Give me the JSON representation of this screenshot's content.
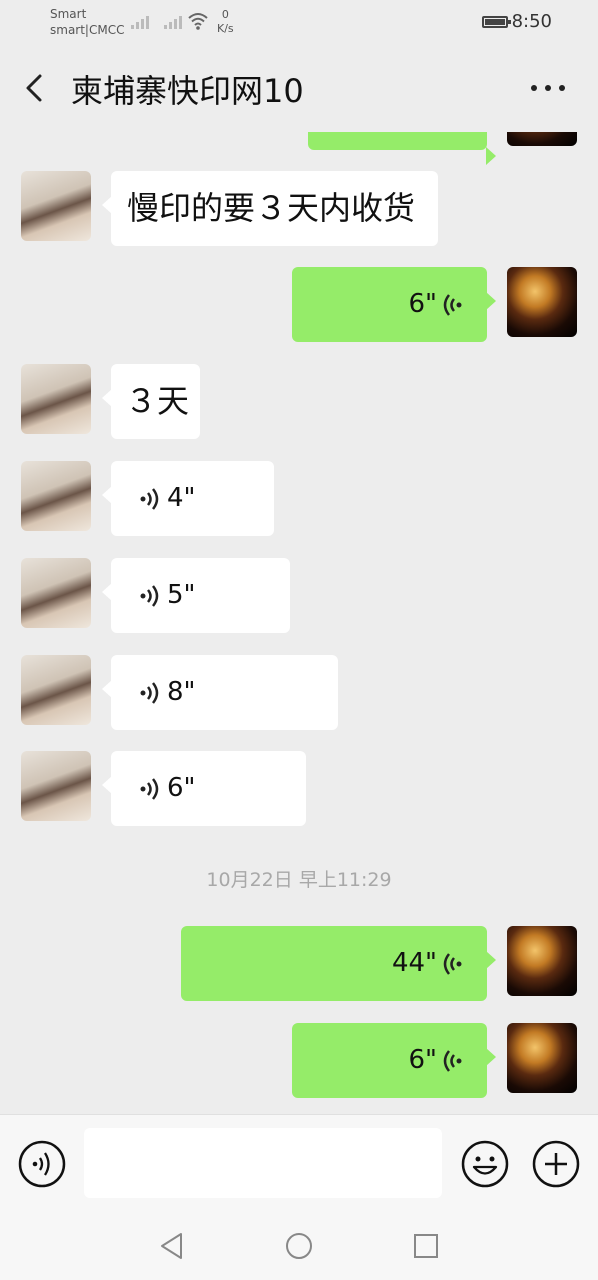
{
  "status_bar": {
    "carrier_line1": "Smart",
    "carrier_line2": "smart|CMCC",
    "speed_value": "0",
    "speed_unit": "K/s",
    "time": "8:50"
  },
  "header": {
    "title": "柬埔寨快印网10"
  },
  "messages": [
    {
      "side": "left",
      "type": "text",
      "text": "慢印的要３天内收货"
    },
    {
      "side": "right",
      "type": "voice",
      "duration": "6\""
    },
    {
      "side": "left",
      "type": "text",
      "text": "３天"
    },
    {
      "side": "left",
      "type": "voice",
      "duration": "4\""
    },
    {
      "side": "left",
      "type": "voice",
      "duration": "5\""
    },
    {
      "side": "left",
      "type": "voice",
      "duration": "8\""
    },
    {
      "side": "left",
      "type": "voice",
      "duration": "6\""
    },
    {
      "side": "right",
      "type": "voice",
      "duration": "44\""
    },
    {
      "side": "right",
      "type": "voice",
      "duration": "6\""
    }
  ],
  "timestamp": "10月22日 早上11:29",
  "input": {
    "value": "",
    "placeholder": ""
  },
  "icons": {
    "back": "chevron-left-icon",
    "more": "more-dots-icon",
    "voice_input": "voice-input-icon",
    "emoji": "emoji-icon",
    "add": "plus-circle-icon",
    "nav_back": "triangle-back-icon",
    "nav_home": "circle-home-icon",
    "nav_recent": "square-recent-icon"
  },
  "colors": {
    "background": "#ededed",
    "sent_bubble": "#95ec69",
    "received_bubble": "#ffffff"
  }
}
